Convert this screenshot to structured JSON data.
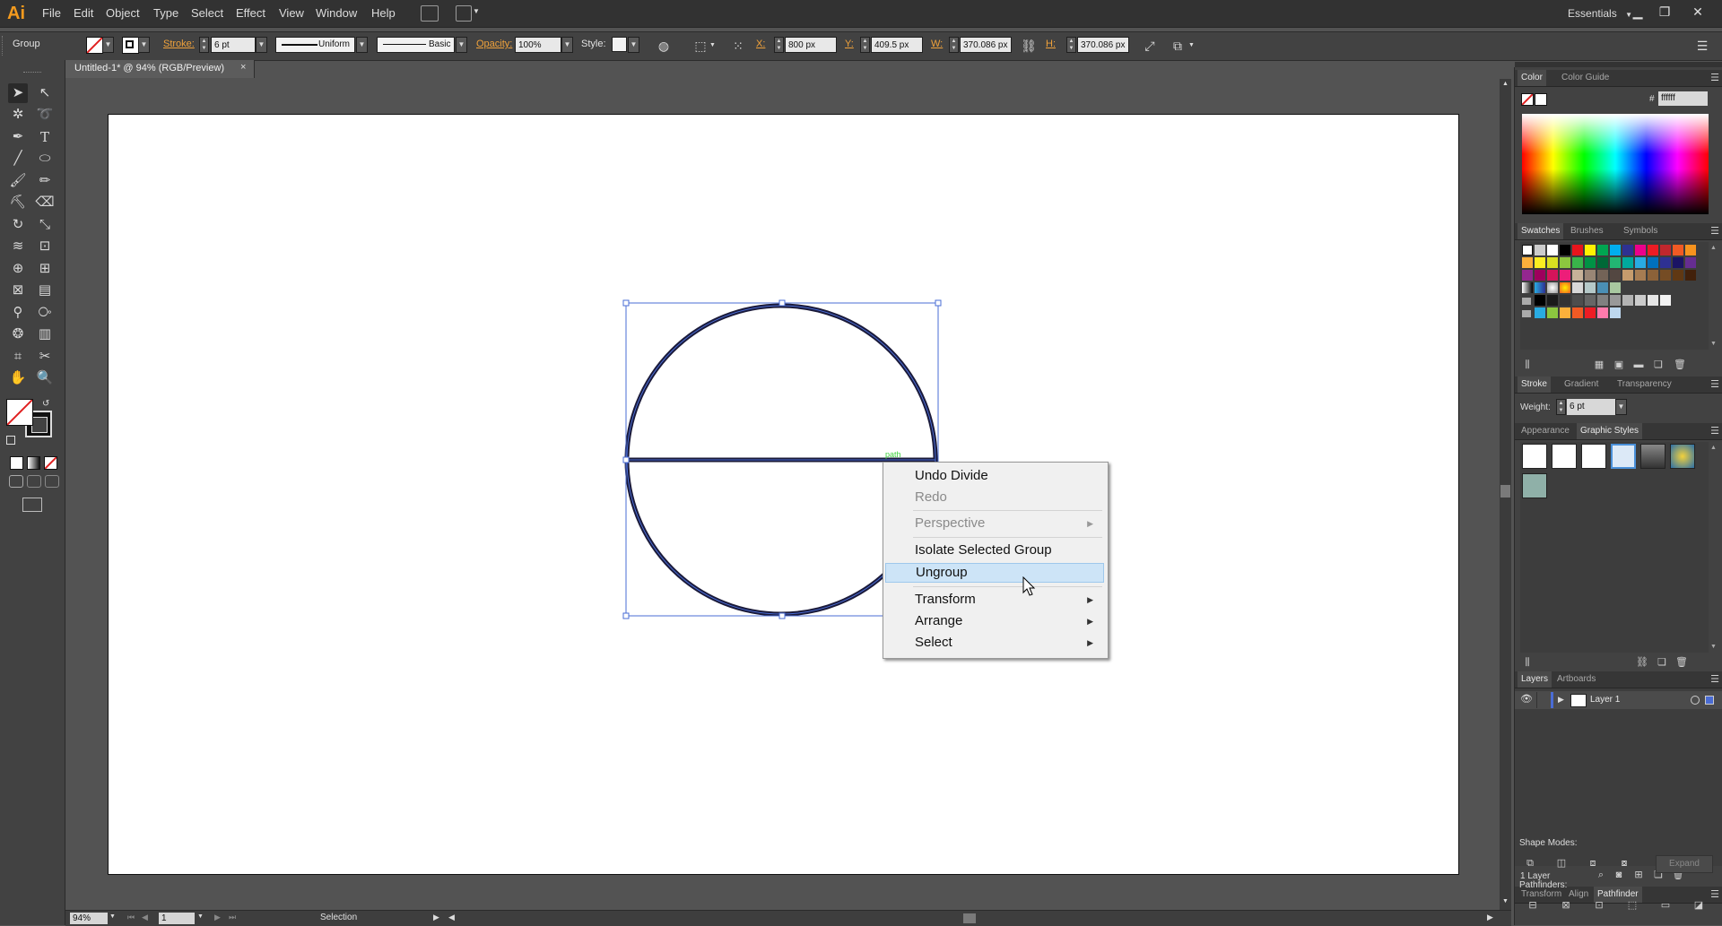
{
  "app": {
    "logo": "Ai",
    "menus": [
      "File",
      "Edit",
      "Object",
      "Type",
      "Select",
      "Effect",
      "View",
      "Window",
      "Help"
    ],
    "workspace": "Essentials"
  },
  "control_bar": {
    "selection_type": "Group",
    "stroke_label": "Stroke:",
    "stroke_weight": "6 pt",
    "variable_width": "Uniform",
    "brush": "Basic",
    "opacity_label": "Opacity:",
    "opacity": "100%",
    "style_label": "Style:",
    "x_label": "X:",
    "x": "800 px",
    "y_label": "Y:",
    "y": "409.5 px",
    "w_label": "W:",
    "w": "370.086 px",
    "h_label": "H:",
    "h": "370.086 px"
  },
  "document": {
    "tab_title": "Untitled-1* @ 94% (RGB/Preview)",
    "close_glyph": "×",
    "path_hint": "path"
  },
  "status_bar": {
    "zoom": "94%",
    "artboard_number": "1",
    "tool_status": "Selection"
  },
  "context_menu": {
    "items": [
      {
        "label": "Undo Divide",
        "disabled": false,
        "submenu": false
      },
      {
        "label": "Redo",
        "disabled": true,
        "submenu": false
      },
      {
        "label": "Perspective",
        "disabled": true,
        "submenu": true
      },
      {
        "label": "Isolate Selected Group",
        "disabled": false,
        "submenu": false
      },
      {
        "label": "Ungroup",
        "disabled": false,
        "submenu": false,
        "hovered": true
      },
      {
        "label": "Transform",
        "disabled": false,
        "submenu": true
      },
      {
        "label": "Arrange",
        "disabled": false,
        "submenu": true
      },
      {
        "label": "Select",
        "disabled": false,
        "submenu": true
      }
    ]
  },
  "panels": {
    "color": {
      "tabs": [
        "Color",
        "Color Guide"
      ],
      "hex": "ffffff"
    },
    "swatches": {
      "tabs": [
        "Swatches",
        "Brushes",
        "Symbols"
      ]
    },
    "stroke": {
      "tabs": [
        "Stroke",
        "Gradient",
        "Transparency"
      ],
      "weight_label": "Weight:",
      "weight": "6 pt"
    },
    "appearance": {
      "tabs": [
        "Appearance",
        "Graphic Styles"
      ]
    },
    "layers": {
      "tabs": [
        "Layers",
        "Artboards"
      ],
      "layer_name": "Layer 1",
      "count": "1 Layer"
    },
    "pathfinder": {
      "tabs": [
        "Transform",
        "Align",
        "Pathfinder"
      ],
      "shape_modes_label": "Shape Modes:",
      "expand_label": "Expand",
      "pathfinders_label": "Pathfinders:"
    }
  },
  "colors": {
    "selection_blue": "#4a6cd4",
    "menu_hover": "#cde4f7",
    "accent_orange": "#f0a23b"
  }
}
